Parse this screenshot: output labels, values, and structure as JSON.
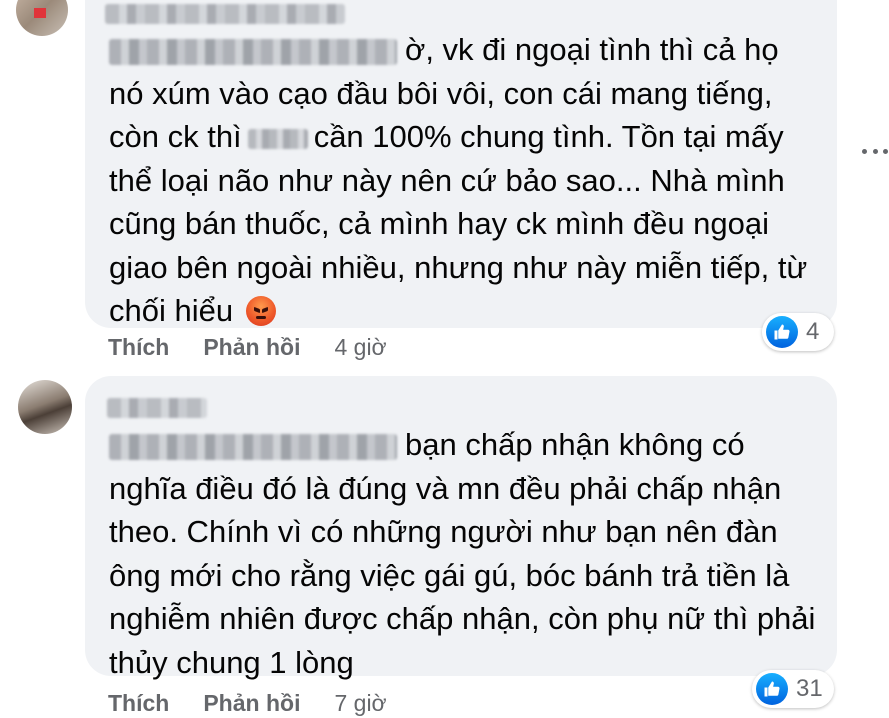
{
  "comments": [
    {
      "author_hidden": true,
      "tagged_hidden": true,
      "lines": [
        "ờ, vk đi ngoại tình thì cả họ",
        "nó xúm vào cạo đầu bôi vôi, con cái mang tiếng,",
        "còn ck thì",
        "cần 100% chung tình. Tồn tại mấy",
        "thể loại não như này nên cứ bảo sao... Nhà mình",
        "cũng bán thuốc, cả mình hay ck mình đều ngoại",
        "giao bên ngoài nhiều, nhưng như này miễn tiếp, từ",
        "chối hiểu"
      ],
      "emoji_icon": "angry-face-emoji",
      "like_label": "Thích",
      "reply_label": "Phản hồi",
      "time": "4 giờ",
      "reaction_icon": "like-icon",
      "reaction_count": "4"
    },
    {
      "author_hidden": true,
      "tagged_hidden": true,
      "lines": [
        "bạn chấp nhận không có",
        "nghĩa điều đó là đúng và mn đều phải chấp nhận",
        "theo. Chính vì có những người như bạn nên đàn",
        "ông mới cho rằng việc gái gú, bóc bánh trả tiền là",
        "nghiễm nhiên được chấp nhận, còn phụ nữ thì phải",
        "thủy chung 1 lòng"
      ],
      "like_label": "Thích",
      "reply_label": "Phản hồi",
      "time": "7 giờ",
      "reaction_icon": "like-icon",
      "reaction_count": "31"
    }
  ],
  "more_icon": "more-horizontal-icon",
  "colors": {
    "bubble": "#f0f2f5",
    "text": "#050505",
    "meta": "#65676b",
    "like_blue": "#0866ff"
  }
}
